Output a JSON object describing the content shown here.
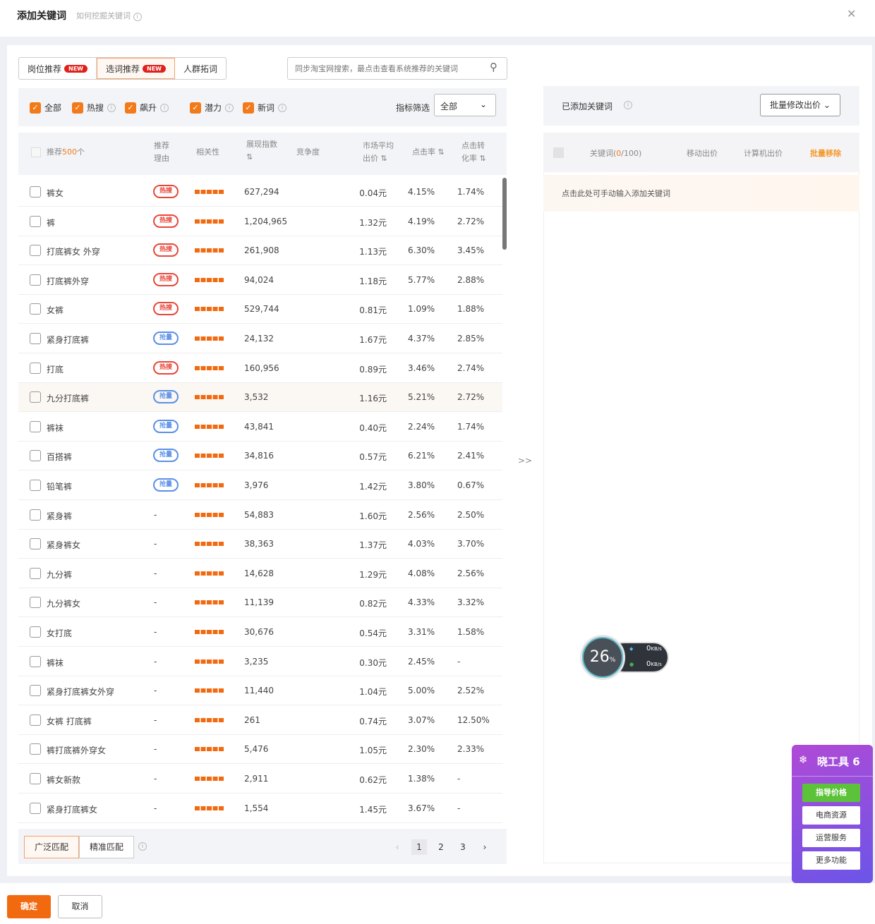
{
  "header": {
    "title": "添加关键词",
    "subtitle": "如何挖掘关键词",
    "close_icon": "close-icon"
  },
  "tabs": [
    {
      "label": "岗位推荐",
      "badge": "NEW"
    },
    {
      "label": "选词推荐",
      "badge": "NEW",
      "active": true
    },
    {
      "label": "人群拓词"
    }
  ],
  "search": {
    "placeholder": "同步淘宝网搜索，最点击查看系统推荐的关键词"
  },
  "filters": {
    "items": [
      "全部",
      "热搜",
      "飙升",
      "潜力",
      "新词"
    ],
    "dropdown_label": "指标筛选",
    "dropdown_value": "全部"
  },
  "table": {
    "headers": {
      "keyword": "推荐",
      "count": "500",
      "count_suffix": "个",
      "reason": "推荐理由",
      "relevance": "相关性",
      "search_index": "展现指数",
      "competition": "竞争度",
      "avg_price": "市场平均出价",
      "ctr": "点击率",
      "cvr": "点击转化率"
    },
    "rows": [
      {
        "kw": "裤女",
        "reason": "热搜",
        "tag": "red",
        "idx": "627,294",
        "price": "0.04元",
        "ctr": "4.15%",
        "cvr": "1.74%"
      },
      {
        "kw": "裤",
        "reason": "热搜",
        "tag": "red",
        "idx": "1,204,965",
        "price": "1.32元",
        "ctr": "4.19%",
        "cvr": "2.72%"
      },
      {
        "kw": "打底裤女 外穿",
        "reason": "热搜",
        "tag": "red",
        "idx": "261,908",
        "price": "1.13元",
        "ctr": "6.30%",
        "cvr": "3.45%"
      },
      {
        "kw": "打底裤外穿",
        "reason": "热搜",
        "tag": "red",
        "idx": "94,024",
        "price": "1.18元",
        "ctr": "5.77%",
        "cvr": "2.88%"
      },
      {
        "kw": "女裤",
        "reason": "热搜",
        "tag": "red",
        "idx": "529,744",
        "price": "0.81元",
        "ctr": "1.09%",
        "cvr": "1.88%"
      },
      {
        "kw": "紧身打底裤",
        "reason": "抢量",
        "tag": "blue",
        "idx": "24,132",
        "price": "1.67元",
        "ctr": "4.37%",
        "cvr": "2.85%"
      },
      {
        "kw": "打底",
        "reason": "热搜",
        "tag": "red",
        "idx": "160,956",
        "price": "0.89元",
        "ctr": "3.46%",
        "cvr": "2.74%"
      },
      {
        "kw": "九分打底裤",
        "reason": "抢量",
        "tag": "blue",
        "idx": "3,532",
        "price": "1.16元",
        "ctr": "5.21%",
        "cvr": "2.72%",
        "hl": true
      },
      {
        "kw": "裤袜",
        "reason": "抢量",
        "tag": "blue",
        "idx": "43,841",
        "price": "0.40元",
        "ctr": "2.24%",
        "cvr": "1.74%"
      },
      {
        "kw": "百搭裤",
        "reason": "抢量",
        "tag": "blue",
        "idx": "34,816",
        "price": "0.57元",
        "ctr": "6.21%",
        "cvr": "2.41%"
      },
      {
        "kw": "铅笔裤",
        "reason": "抢量",
        "tag": "blue",
        "idx": "3,976",
        "price": "1.42元",
        "ctr": "3.80%",
        "cvr": "0.67%"
      },
      {
        "kw": "紧身裤",
        "reason": "-",
        "idx": "54,883",
        "price": "1.60元",
        "ctr": "2.56%",
        "cvr": "2.50%"
      },
      {
        "kw": "紧身裤女",
        "reason": "-",
        "idx": "38,363",
        "price": "1.37元",
        "ctr": "4.03%",
        "cvr": "3.70%"
      },
      {
        "kw": "九分裤",
        "reason": "-",
        "idx": "14,628",
        "price": "1.29元",
        "ctr": "4.08%",
        "cvr": "2.56%"
      },
      {
        "kw": "九分裤女",
        "reason": "-",
        "idx": "11,139",
        "price": "0.82元",
        "ctr": "4.33%",
        "cvr": "3.32%"
      },
      {
        "kw": "女打底",
        "reason": "-",
        "idx": "30,676",
        "price": "0.54元",
        "ctr": "3.31%",
        "cvr": "1.58%"
      },
      {
        "kw": "裤袜",
        "reason": "-",
        "idx": "3,235",
        "price": "0.30元",
        "ctr": "2.45%",
        "cvr": "-"
      },
      {
        "kw": "紧身打底裤女外穿",
        "reason": "-",
        "idx": "11,440",
        "price": "1.04元",
        "ctr": "5.00%",
        "cvr": "2.52%"
      },
      {
        "kw": "女裤 打底裤",
        "reason": "-",
        "idx": "261",
        "price": "0.74元",
        "ctr": "3.07%",
        "cvr": "12.50%"
      },
      {
        "kw": "裤打底裤外穿女",
        "reason": "-",
        "idx": "5,476",
        "price": "1.05元",
        "ctr": "2.30%",
        "cvr": "2.33%"
      },
      {
        "kw": "裤女新款",
        "reason": "-",
        "idx": "2,911",
        "price": "0.62元",
        "ctr": "1.38%",
        "cvr": "-"
      },
      {
        "kw": "紧身打底裤女",
        "reason": "-",
        "idx": "1,554",
        "price": "1.45元",
        "ctr": "3.67%",
        "cvr": "-"
      }
    ]
  },
  "match": {
    "broad": "广泛匹配",
    "exact": "精准匹配"
  },
  "pagination": {
    "pages": [
      "1",
      "2",
      "3"
    ],
    "current": "1"
  },
  "transfer": ">>",
  "right": {
    "title": "已添加关键词",
    "bid_button": "批量修改出价",
    "col_keyword": "关键词",
    "count": "0",
    "limit": "/100",
    "col_pc": "移动出价",
    "col_mobile": "计算机出价",
    "col_remove": "批量移除",
    "hint": "点击此处可手动输入添加关键词"
  },
  "widget": {
    "percent": "26",
    "unit": "%",
    "up": "0",
    "down": "0",
    "rate_unit": "KB/s"
  },
  "toolbox": {
    "title": "晓工具 6",
    "buttons": [
      "指导价格",
      "电商资源",
      "运营服务",
      "更多功能"
    ]
  },
  "footer": {
    "confirm": "确定",
    "cancel": "取消"
  },
  "colors": {
    "accent": "#f26a10",
    "hot": "#e8463a",
    "blue": "#5a8fe6"
  }
}
